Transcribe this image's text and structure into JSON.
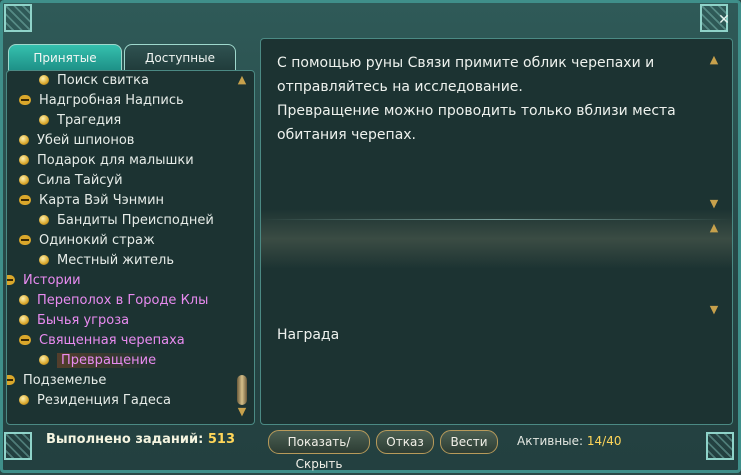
{
  "tabs": {
    "accepted": "Принятые",
    "available": "Доступные"
  },
  "quest_tree": [
    {
      "label": "Поиск свитка",
      "level": 2,
      "marker": "dot",
      "style": "normal"
    },
    {
      "label": "Надгробная Надпись",
      "level": 1,
      "marker": "minus",
      "style": "normal"
    },
    {
      "label": "Трагедия",
      "level": 2,
      "marker": "dot",
      "style": "normal"
    },
    {
      "label": "Убей шпионов",
      "level": 1,
      "marker": "dot",
      "style": "normal"
    },
    {
      "label": "Подарок для малышки",
      "level": 1,
      "marker": "dot",
      "style": "normal"
    },
    {
      "label": "Сила Тайсуй",
      "level": 1,
      "marker": "dot",
      "style": "normal"
    },
    {
      "label": "Карта Вэй Чэнмин",
      "level": 1,
      "marker": "minus",
      "style": "normal"
    },
    {
      "label": "Бандиты Преисподней",
      "level": 2,
      "marker": "dot",
      "style": "normal"
    },
    {
      "label": "Одинокий страж",
      "level": 1,
      "marker": "minus",
      "style": "normal"
    },
    {
      "label": "Местный житель",
      "level": 2,
      "marker": "dot",
      "style": "normal"
    },
    {
      "label": "Истории",
      "level": 0,
      "marker": "minus",
      "style": "pink"
    },
    {
      "label": "Переполох в Городе Клы",
      "level": 1,
      "marker": "dot",
      "style": "pink"
    },
    {
      "label": "Бычья угроза",
      "level": 1,
      "marker": "dot",
      "style": "pink"
    },
    {
      "label": "Священная черепаха",
      "level": 1,
      "marker": "minus",
      "style": "pink"
    },
    {
      "label": "Превращение",
      "level": 2,
      "marker": "dot",
      "style": "selected"
    },
    {
      "label": "Подземелье",
      "level": 0,
      "marker": "minus",
      "style": "normal"
    },
    {
      "label": "Резиденция Гадеса",
      "level": 1,
      "marker": "dot",
      "style": "normal"
    }
  ],
  "description": {
    "line1": "С помощью руны Связи примите облик черепахи и",
    "line2": "отправляйтесь на исследование.",
    "line3": "Превращение можно проводить только вблизи места",
    "line4": "обитания черепах."
  },
  "reward_label": "Награда",
  "footer": {
    "completed_label": "Выполнено заданий:",
    "completed_value": "513",
    "show_hide": "Показать/Скрыть",
    "refuse": "Отказ",
    "lead": "Вести",
    "active_label": "Активные:",
    "active_value": "14/40"
  },
  "colors": {
    "frame": "#3f8f8a",
    "accent_gold": "#ffd659",
    "story_pink": "#e88bf0",
    "active_tab": "#35c0ae"
  },
  "icons": {
    "close": "close-icon",
    "scroll_up": "arrow-up-icon",
    "scroll_down": "arrow-down-icon",
    "collapse": "minus-icon",
    "bullet": "gold-dot-icon"
  }
}
